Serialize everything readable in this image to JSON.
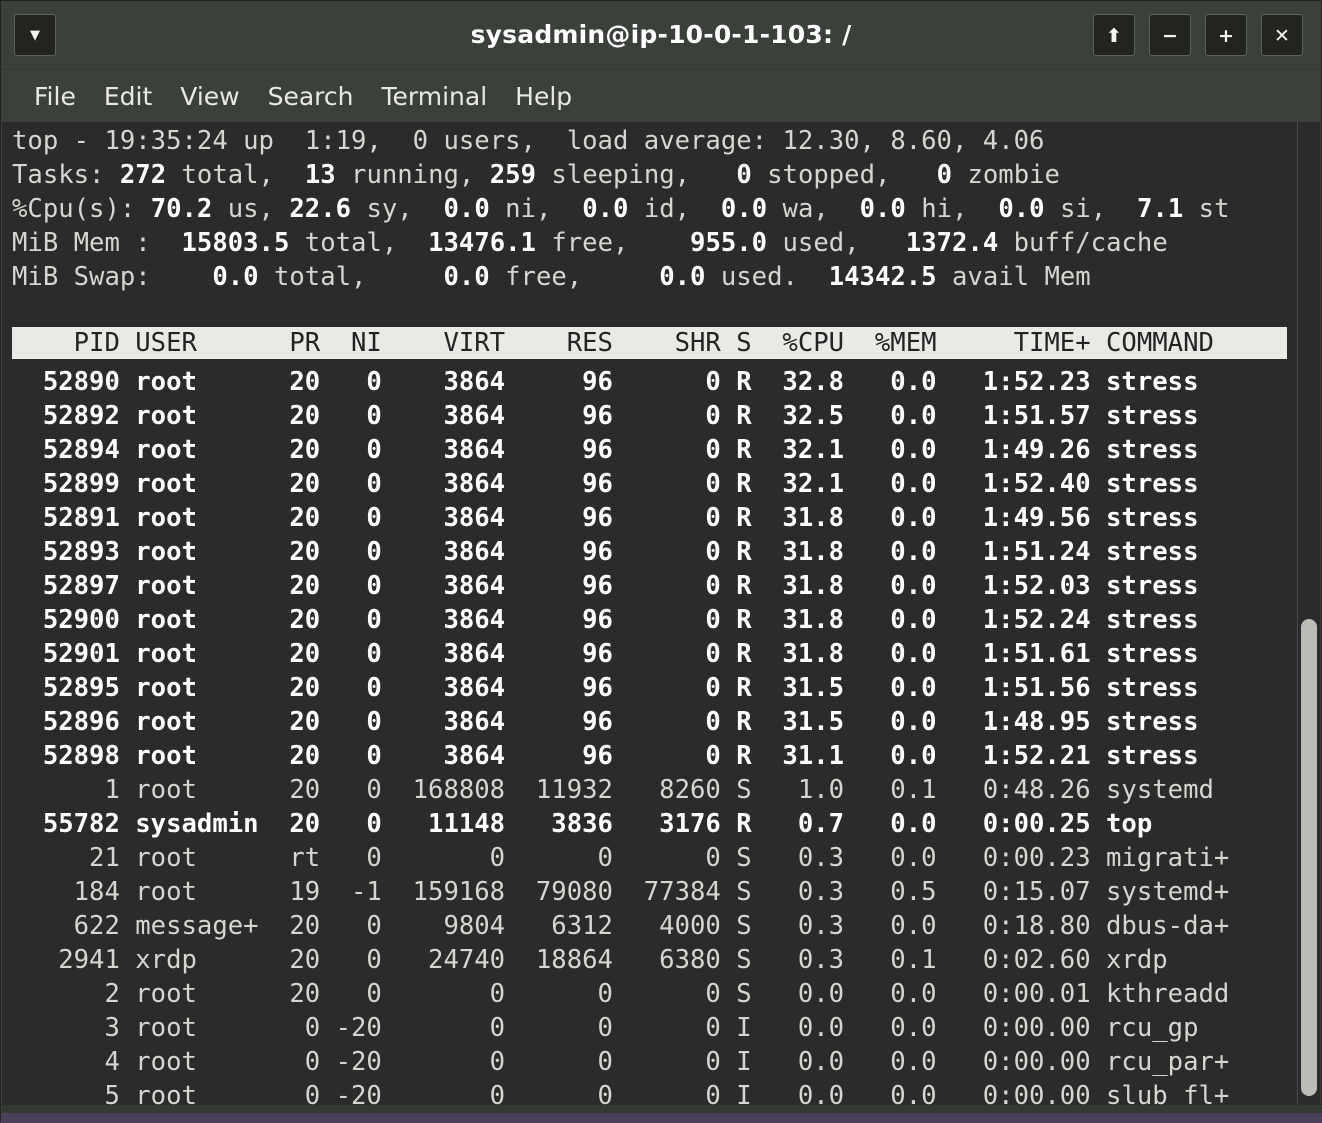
{
  "window": {
    "title": "sysadmin@ip-10-0-1-103: /",
    "buttons": {
      "menu": "▼",
      "shade": "⬆",
      "minimize": "−",
      "maximize": "+",
      "close": "✕"
    }
  },
  "menubar": {
    "items": [
      "File",
      "Edit",
      "View",
      "Search",
      "Terminal",
      "Help"
    ]
  },
  "summary": {
    "line1": {
      "prefix": "top - ",
      "time": "19:35:24",
      "up_label": " up ",
      "uptime": " 1:19,",
      "users": "  0 users,",
      "load_label": "  load average: ",
      "load": "12.30, 8.60, 4.06"
    },
    "line2": {
      "label": "Tasks:",
      "total": "272",
      "total_label": " total,",
      "running": "13",
      "running_label": " running,",
      "sleeping": "259",
      "sleeping_label": " sleeping,",
      "stopped": "0",
      "stopped_label": " stopped,",
      "zombie": "0",
      "zombie_label": " zombie"
    },
    "line3": {
      "label": "%Cpu(s):",
      "us": "70.2",
      "us_label": " us,",
      "sy": "22.6",
      "sy_label": " sy,",
      "ni": "0.0",
      "ni_label": " ni,",
      "id": "0.0",
      "id_label": " id,",
      "wa": "0.0",
      "wa_label": " wa,",
      "hi": "0.0",
      "hi_label": " hi,",
      "si": "0.0",
      "si_label": " si,",
      "st": "7.1",
      "st_label": " st"
    },
    "line4": {
      "label": "MiB Mem :",
      "total": "15803.5",
      "total_label": " total,",
      "free": "13476.1",
      "free_label": " free,",
      "used": "955.0",
      "used_label": " used,",
      "buff": "1372.4",
      "buff_label": " buff/cache"
    },
    "line5": {
      "label": "MiB Swap:",
      "total": "0.0",
      "total_label": " total,",
      "free": "0.0",
      "free_label": " free,",
      "used": "0.0",
      "used_label": " used.",
      "avail": "14342.5",
      "avail_label": " avail Mem"
    }
  },
  "table": {
    "headers": [
      "PID",
      "USER",
      "PR",
      "NI",
      "VIRT",
      "RES",
      "SHR",
      "S",
      "%CPU",
      "%MEM",
      "TIME+",
      "COMMAND"
    ],
    "header_line": "    PID USER      PR  NI    VIRT    RES    SHR S  %CPU  %MEM     TIME+ COMMAND",
    "rows": [
      {
        "pid": "52890",
        "user": "root",
        "pr": "20",
        "ni": "0",
        "virt": "3864",
        "res": "96",
        "shr": "0",
        "s": "R",
        "cpu": "32.8",
        "mem": "0.0",
        "time": "1:52.23",
        "command": "stress",
        "bold": true
      },
      {
        "pid": "52892",
        "user": "root",
        "pr": "20",
        "ni": "0",
        "virt": "3864",
        "res": "96",
        "shr": "0",
        "s": "R",
        "cpu": "32.5",
        "mem": "0.0",
        "time": "1:51.57",
        "command": "stress",
        "bold": true
      },
      {
        "pid": "52894",
        "user": "root",
        "pr": "20",
        "ni": "0",
        "virt": "3864",
        "res": "96",
        "shr": "0",
        "s": "R",
        "cpu": "32.1",
        "mem": "0.0",
        "time": "1:49.26",
        "command": "stress",
        "bold": true
      },
      {
        "pid": "52899",
        "user": "root",
        "pr": "20",
        "ni": "0",
        "virt": "3864",
        "res": "96",
        "shr": "0",
        "s": "R",
        "cpu": "32.1",
        "mem": "0.0",
        "time": "1:52.40",
        "command": "stress",
        "bold": true
      },
      {
        "pid": "52891",
        "user": "root",
        "pr": "20",
        "ni": "0",
        "virt": "3864",
        "res": "96",
        "shr": "0",
        "s": "R",
        "cpu": "31.8",
        "mem": "0.0",
        "time": "1:49.56",
        "command": "stress",
        "bold": true
      },
      {
        "pid": "52893",
        "user": "root",
        "pr": "20",
        "ni": "0",
        "virt": "3864",
        "res": "96",
        "shr": "0",
        "s": "R",
        "cpu": "31.8",
        "mem": "0.0",
        "time": "1:51.24",
        "command": "stress",
        "bold": true
      },
      {
        "pid": "52897",
        "user": "root",
        "pr": "20",
        "ni": "0",
        "virt": "3864",
        "res": "96",
        "shr": "0",
        "s": "R",
        "cpu": "31.8",
        "mem": "0.0",
        "time": "1:52.03",
        "command": "stress",
        "bold": true
      },
      {
        "pid": "52900",
        "user": "root",
        "pr": "20",
        "ni": "0",
        "virt": "3864",
        "res": "96",
        "shr": "0",
        "s": "R",
        "cpu": "31.8",
        "mem": "0.0",
        "time": "1:52.24",
        "command": "stress",
        "bold": true
      },
      {
        "pid": "52901",
        "user": "root",
        "pr": "20",
        "ni": "0",
        "virt": "3864",
        "res": "96",
        "shr": "0",
        "s": "R",
        "cpu": "31.8",
        "mem": "0.0",
        "time": "1:51.61",
        "command": "stress",
        "bold": true
      },
      {
        "pid": "52895",
        "user": "root",
        "pr": "20",
        "ni": "0",
        "virt": "3864",
        "res": "96",
        "shr": "0",
        "s": "R",
        "cpu": "31.5",
        "mem": "0.0",
        "time": "1:51.56",
        "command": "stress",
        "bold": true
      },
      {
        "pid": "52896",
        "user": "root",
        "pr": "20",
        "ni": "0",
        "virt": "3864",
        "res": "96",
        "shr": "0",
        "s": "R",
        "cpu": "31.5",
        "mem": "0.0",
        "time": "1:48.95",
        "command": "stress",
        "bold": true
      },
      {
        "pid": "52898",
        "user": "root",
        "pr": "20",
        "ni": "0",
        "virt": "3864",
        "res": "96",
        "shr": "0",
        "s": "R",
        "cpu": "31.1",
        "mem": "0.0",
        "time": "1:52.21",
        "command": "stress",
        "bold": true
      },
      {
        "pid": "1",
        "user": "root",
        "pr": "20",
        "ni": "0",
        "virt": "168808",
        "res": "11932",
        "shr": "8260",
        "s": "S",
        "cpu": "1.0",
        "mem": "0.1",
        "time": "0:48.26",
        "command": "systemd",
        "bold": false
      },
      {
        "pid": "55782",
        "user": "sysadmin",
        "pr": "20",
        "ni": "0",
        "virt": "11148",
        "res": "3836",
        "shr": "3176",
        "s": "R",
        "cpu": "0.7",
        "mem": "0.0",
        "time": "0:00.25",
        "command": "top",
        "bold": true
      },
      {
        "pid": "21",
        "user": "root",
        "pr": "rt",
        "ni": "0",
        "virt": "0",
        "res": "0",
        "shr": "0",
        "s": "S",
        "cpu": "0.3",
        "mem": "0.0",
        "time": "0:00.23",
        "command": "migrati+",
        "bold": false
      },
      {
        "pid": "184",
        "user": "root",
        "pr": "19",
        "ni": "-1",
        "virt": "159168",
        "res": "79080",
        "shr": "77384",
        "s": "S",
        "cpu": "0.3",
        "mem": "0.5",
        "time": "0:15.07",
        "command": "systemd+",
        "bold": false
      },
      {
        "pid": "622",
        "user": "message+",
        "pr": "20",
        "ni": "0",
        "virt": "9804",
        "res": "6312",
        "shr": "4000",
        "s": "S",
        "cpu": "0.3",
        "mem": "0.0",
        "time": "0:18.80",
        "command": "dbus-da+",
        "bold": false
      },
      {
        "pid": "2941",
        "user": "xrdp",
        "pr": "20",
        "ni": "0",
        "virt": "24740",
        "res": "18864",
        "shr": "6380",
        "s": "S",
        "cpu": "0.3",
        "mem": "0.1",
        "time": "0:02.60",
        "command": "xrdp",
        "bold": false
      },
      {
        "pid": "2",
        "user": "root",
        "pr": "20",
        "ni": "0",
        "virt": "0",
        "res": "0",
        "shr": "0",
        "s": "S",
        "cpu": "0.0",
        "mem": "0.0",
        "time": "0:00.01",
        "command": "kthreadd",
        "bold": false
      },
      {
        "pid": "3",
        "user": "root",
        "pr": "0",
        "ni": "-20",
        "virt": "0",
        "res": "0",
        "shr": "0",
        "s": "I",
        "cpu": "0.0",
        "mem": "0.0",
        "time": "0:00.00",
        "command": "rcu_gp",
        "bold": false
      },
      {
        "pid": "4",
        "user": "root",
        "pr": "0",
        "ni": "-20",
        "virt": "0",
        "res": "0",
        "shr": "0",
        "s": "I",
        "cpu": "0.0",
        "mem": "0.0",
        "time": "0:00.00",
        "command": "rcu_par+",
        "bold": false
      },
      {
        "pid": "5",
        "user": "root",
        "pr": "0",
        "ni": "-20",
        "virt": "0",
        "res": "0",
        "shr": "0",
        "s": "I",
        "cpu": "0.0",
        "mem": "0.0",
        "time": "0:00.00",
        "command": "slub_fl+",
        "bold": false
      }
    ]
  },
  "scrollbar": {
    "thumb_top_pct": 50,
    "thumb_height_pct": 48
  },
  "colors": {
    "terminal_bg": "#2b2b2b",
    "terminal_fg": "#d6d6d0",
    "frame_bg": "#3b403b",
    "header_bg": "#e9e9e5",
    "header_fg": "#232323",
    "accent": "#4b3f59"
  }
}
